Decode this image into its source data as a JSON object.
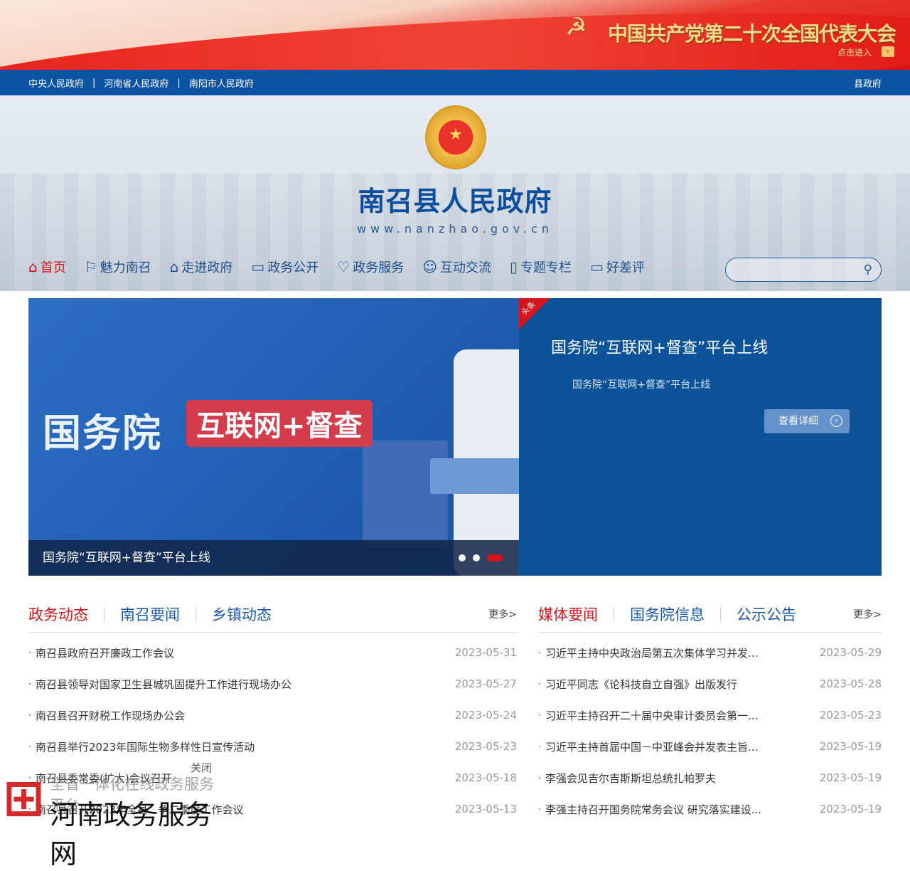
{
  "banner": {
    "title": "中国共产党第二十次全国代表大会",
    "enter": "点击进入"
  },
  "topbar": {
    "links": [
      "中央人民政府",
      "河南省人民政府",
      "南阳市人民政府"
    ],
    "right": "县政府"
  },
  "header": {
    "site_name": "南召县人民政府",
    "url": "www.nanzhao.gov.cn"
  },
  "nav": [
    "首页",
    "魅力南召",
    "走进政府",
    "政务公开",
    "政务服务",
    "互动交流",
    "专题专栏",
    "好差评"
  ],
  "search": {
    "placeholder": ""
  },
  "slider": {
    "img_text1": "国务院",
    "img_text2": "互联网+督查",
    "caption": "国务院“互联网+督查”平台上线",
    "tag": "头条",
    "title": "国务院“互联网+督查”平台上线",
    "subtitle": "国务院“互联网+督查”平台上线",
    "detail": "查看详细",
    "active_slide": 3,
    "slide_count": 3
  },
  "left_news": {
    "tabs": [
      "政务动态",
      "南召要闻",
      "乡镇动态"
    ],
    "more": "更多>",
    "items": [
      {
        "title": "南召县政府召开廉政工作会议",
        "date": "2023-05-31"
      },
      {
        "title": "南召县领导对国家卫生县城巩固提升工作进行现场办公",
        "date": "2023-05-27"
      },
      {
        "title": "南召县召开财税工作现场办公会",
        "date": "2023-05-24"
      },
      {
        "title": "南召县举行2023年国际生物多样性日宣传活动",
        "date": "2023-05-23"
      },
      {
        "title": "南召县委常委(扩大)会议召开",
        "date": "2023-05-18"
      },
      {
        "title": "南召县召开2023年全县...争二季度工作会议",
        "date": "2023-05-13"
      }
    ]
  },
  "right_news": {
    "tabs": [
      "媒体要闻",
      "国务院信息",
      "公示公告"
    ],
    "more": "更多>",
    "items": [
      {
        "title": "习近平主持中央政治局第五次集体学习并发...",
        "date": "2023-05-29"
      },
      {
        "title": "习近平同志《论科技自立自强》出版发行",
        "date": "2023-05-28"
      },
      {
        "title": "习近平主持召开二十届中央审计委员会第一...",
        "date": "2023-05-23"
      },
      {
        "title": "习近平主持首届中国－中亚峰会并发表主旨...",
        "date": "2023-05-19"
      },
      {
        "title": "李强会见吉尔吉斯斯坦总统扎帕罗夫",
        "date": "2023-05-19"
      },
      {
        "title": "李强主持召开国务院常务会议 研究落实建设...",
        "date": "2023-05-19"
      }
    ]
  },
  "float": {
    "close": "关闭",
    "line1": "全省一体化在线政务服务平台",
    "line2": "河南政务服务网"
  }
}
